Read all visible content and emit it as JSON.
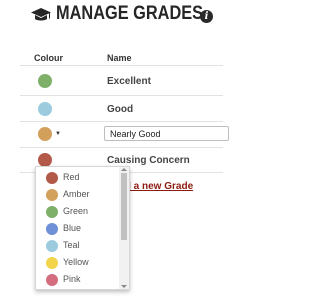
{
  "header": {
    "title": "MANAGE GRADES",
    "icon": "graduation-cap-icon",
    "info_icon": "i"
  },
  "table": {
    "headers": [
      "Colour",
      "Name"
    ],
    "rows": [
      {
        "name": "Excellent",
        "colour": "#7fb06a"
      },
      {
        "name": "Good",
        "colour": "#9ccbde"
      },
      {
        "name": "Nearly Good",
        "colour": "#d3a05b"
      },
      {
        "name": "Causing Concern",
        "colour": "#b3594a"
      }
    ]
  },
  "add_grade_label": "ld a new Grade",
  "colour_options": [
    {
      "label": "Red",
      "color": "#b3594a"
    },
    {
      "label": "Amber",
      "color": "#d3a05b"
    },
    {
      "label": "Green",
      "color": "#7fb06a"
    },
    {
      "label": "Blue",
      "color": "#6f8fd6"
    },
    {
      "label": "Teal",
      "color": "#9ccbde"
    },
    {
      "label": "Yellow",
      "color": "#f2d54b"
    },
    {
      "label": "Pink",
      "color": "#d46d80"
    }
  ]
}
